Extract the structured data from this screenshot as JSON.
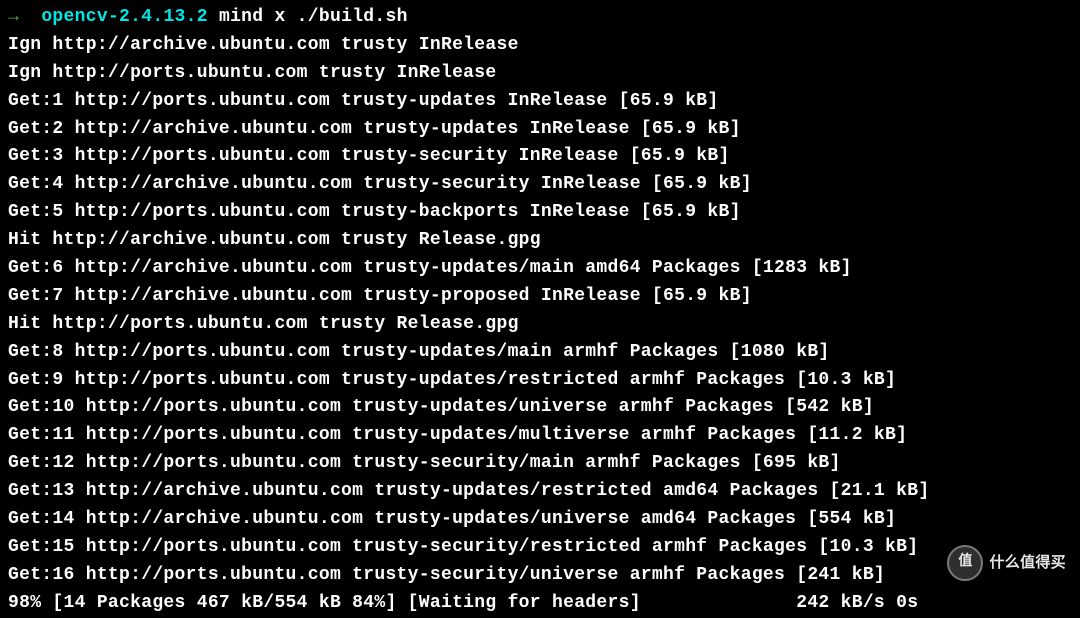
{
  "prompt": {
    "arrow": "→",
    "dir": "opencv-2.4.13.2",
    "command": "mind x ./build.sh"
  },
  "lines": [
    "Ign http://archive.ubuntu.com trusty InRelease",
    "Ign http://ports.ubuntu.com trusty InRelease",
    "Get:1 http://ports.ubuntu.com trusty-updates InRelease [65.9 kB]",
    "Get:2 http://archive.ubuntu.com trusty-updates InRelease [65.9 kB]",
    "Get:3 http://ports.ubuntu.com trusty-security InRelease [65.9 kB]",
    "Get:4 http://archive.ubuntu.com trusty-security InRelease [65.9 kB]",
    "Get:5 http://ports.ubuntu.com trusty-backports InRelease [65.9 kB]",
    "Hit http://archive.ubuntu.com trusty Release.gpg",
    "Get:6 http://archive.ubuntu.com trusty-updates/main amd64 Packages [1283 kB]",
    "Get:7 http://archive.ubuntu.com trusty-proposed InRelease [65.9 kB]",
    "Hit http://ports.ubuntu.com trusty Release.gpg",
    "Get:8 http://ports.ubuntu.com trusty-updates/main armhf Packages [1080 kB]",
    "Get:9 http://ports.ubuntu.com trusty-updates/restricted armhf Packages [10.3 kB]",
    "Get:10 http://ports.ubuntu.com trusty-updates/universe armhf Packages [542 kB]",
    "Get:11 http://ports.ubuntu.com trusty-updates/multiverse armhf Packages [11.2 kB]",
    "Get:12 http://ports.ubuntu.com trusty-security/main armhf Packages [695 kB]",
    "Get:13 http://archive.ubuntu.com trusty-updates/restricted amd64 Packages [21.1 kB]",
    "Get:14 http://archive.ubuntu.com trusty-updates/universe amd64 Packages [554 kB]",
    "Get:15 http://ports.ubuntu.com trusty-security/restricted armhf Packages [10.3 kB]",
    "Get:16 http://ports.ubuntu.com trusty-security/universe armhf Packages [241 kB]",
    "98% [14 Packages 467 kB/554 kB 84%] [Waiting for headers]              242 kB/s 0s"
  ],
  "watermark": {
    "badge": "值",
    "text": "什么值得买"
  }
}
